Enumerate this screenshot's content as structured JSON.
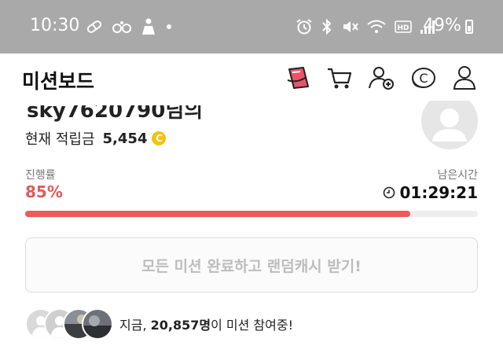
{
  "status_bar": {
    "time": "10:30",
    "battery": "49%",
    "left_icons": [
      "pill-icon",
      "mustache-icon",
      "person-icon",
      "dot-icon"
    ],
    "right_icons": [
      "alarm-icon",
      "bluetooth-icon",
      "mute-icon",
      "wifi-icon",
      "hd-icon",
      "signal-icon",
      "battery-icon"
    ]
  },
  "header": {
    "title": "미션보드",
    "icons": [
      "sticker-icon",
      "cart-icon",
      "add-friend-icon",
      "coin-icon",
      "profile-icon"
    ]
  },
  "profile": {
    "name": "sky7620790님의",
    "balance_label": "현재 적립금",
    "balance_value": "5,454",
    "coin_symbol": "C"
  },
  "progress": {
    "label": "진행률",
    "value_text": "85%",
    "fraction": 0.85,
    "time_label": "남은시간",
    "time_value": "01:29:21"
  },
  "cta": {
    "label": "모든 미션 완료하고 랜덤캐시 받기!"
  },
  "participants": {
    "prefix": "지금, ",
    "count": "20,857명",
    "suffix": "이 미션 참여중!"
  },
  "colors": {
    "accent": "#ee5a5a",
    "status_bar": "#a9a9a9",
    "coin": "#f4c20d"
  }
}
